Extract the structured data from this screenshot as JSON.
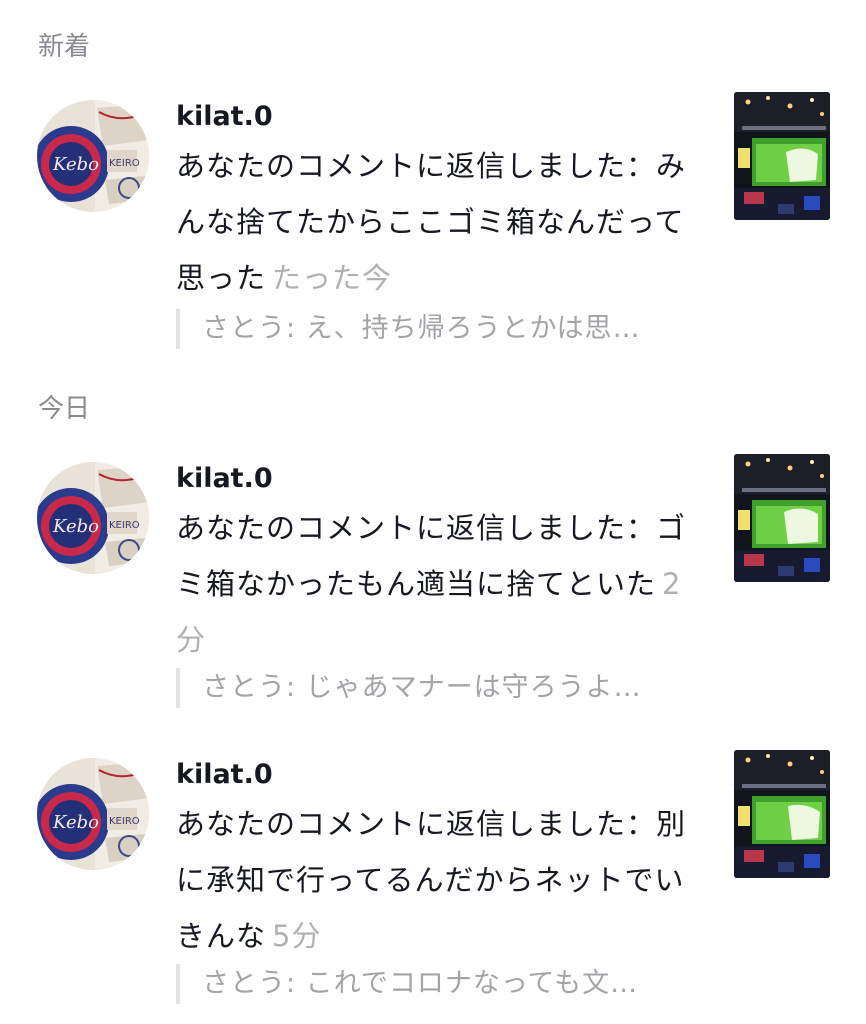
{
  "sections": [
    {
      "header": "新着",
      "items": [
        {
          "username": "kilat.0",
          "message": "あなたのコメントに返信しました：みんな捨てたからここゴミ箱なんだって思った",
          "time": "たった今",
          "reply": "さとう: え、持ち帰ろうとかは思…"
        }
      ]
    },
    {
      "header": "今日",
      "items": [
        {
          "username": "kilat.0",
          "message": "あなたのコメントに返信しました：ゴミ箱なかったもん適当に捨てといた",
          "time": "2分",
          "reply": "さとう: じゃあマナーは守ろうよ…"
        },
        {
          "username": "kilat.0",
          "message": "あなたのコメントに返信しました：別に承知で行ってるんだからネットでいきんな",
          "time": "5分",
          "reply": "さとう: これでコロナなっても文…"
        }
      ]
    }
  ],
  "icons": {
    "avatar": "user-avatar-image",
    "thumbnail": "concert-video-thumbnail"
  },
  "colors": {
    "header_text": "#8a8b91",
    "time_text": "#b0b1b6",
    "reply_text": "#a3a4a9",
    "reply_bar": "#e3e3e4",
    "primary_text": "#161823"
  }
}
